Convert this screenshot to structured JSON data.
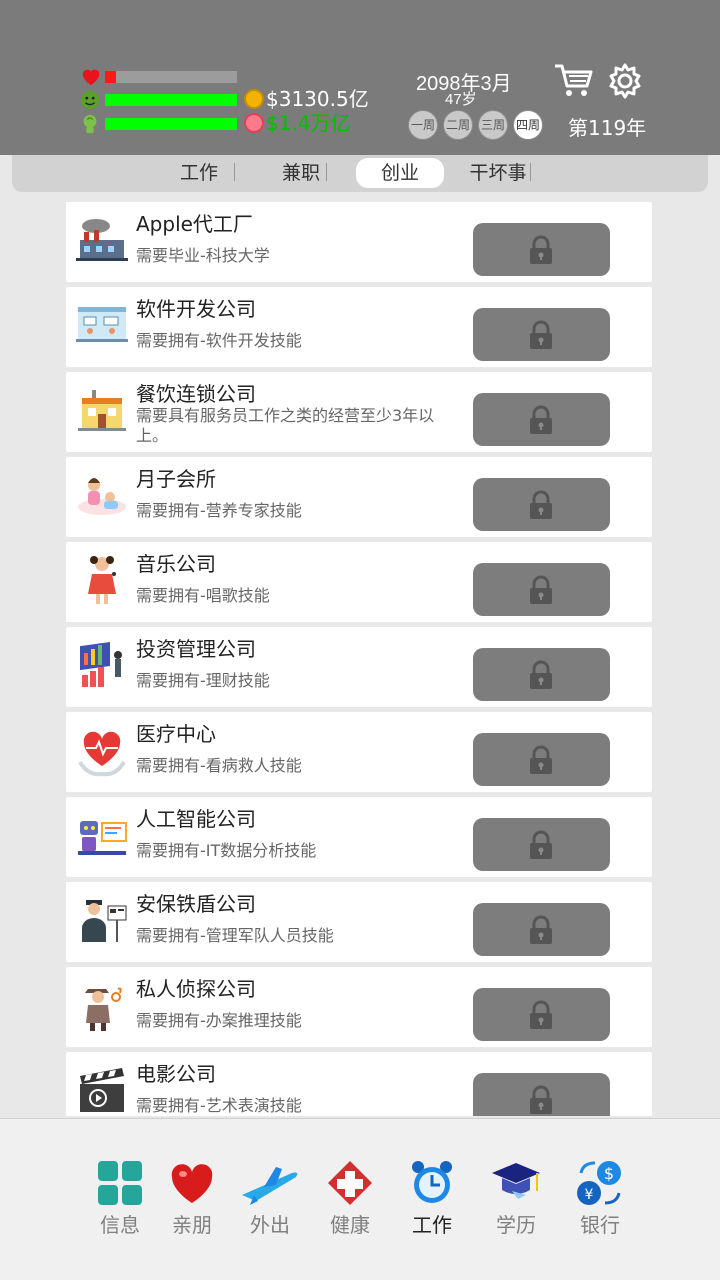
{
  "status": {
    "health_level": 0.08,
    "mood_level": 1.0,
    "energy_level": 1.0,
    "money": "$3130.5亿",
    "debt": "$1.4万亿",
    "date": "2098年3月",
    "age": "47岁",
    "weeks": [
      "一周",
      "二周",
      "三周",
      "四周"
    ],
    "active_week": 3,
    "turn": "第119年"
  },
  "tabs": [
    "工作",
    "兼职",
    "创业",
    "干坏事"
  ],
  "active_tab": 2,
  "businesses": [
    {
      "title": "Apple代工厂",
      "desc": "需要毕业-科技大学",
      "icon": "factory-icon"
    },
    {
      "title": "软件开发公司",
      "desc": "需要拥有-软件开发技能",
      "icon": "office-icon"
    },
    {
      "title": "餐饮连锁公司",
      "desc": "需要具有服务员工作之类的经营至少3年以上。",
      "icon": "restaurant-icon"
    },
    {
      "title": "月子会所",
      "desc": "需要拥有-营养专家技能",
      "icon": "mother-baby-icon"
    },
    {
      "title": "音乐公司",
      "desc": "需要拥有-唱歌技能",
      "icon": "singer-icon"
    },
    {
      "title": "投资管理公司",
      "desc": "需要拥有-理财技能",
      "icon": "investment-icon"
    },
    {
      "title": "医疗中心",
      "desc": "需要拥有-看病救人技能",
      "icon": "heart-medical-icon"
    },
    {
      "title": "人工智能公司",
      "desc": "需要拥有-IT数据分析技能",
      "icon": "robot-icon"
    },
    {
      "title": "安保铁盾公司",
      "desc": "需要拥有-管理军队人员技能",
      "icon": "security-guard-icon"
    },
    {
      "title": "私人侦探公司",
      "desc": "需要拥有-办案推理技能",
      "icon": "detective-icon"
    },
    {
      "title": "电影公司",
      "desc": "需要拥有-艺术表演技能",
      "icon": "clapperboard-icon"
    }
  ],
  "nav": [
    {
      "label": "信息",
      "icon": "info-grid-icon"
    },
    {
      "label": "亲朋",
      "icon": "heart-icon"
    },
    {
      "label": "外出",
      "icon": "airplane-icon"
    },
    {
      "label": "健康",
      "icon": "hospital-cross-icon"
    },
    {
      "label": "工作",
      "icon": "alarm-clock-icon"
    },
    {
      "label": "学历",
      "icon": "graduation-cap-icon"
    },
    {
      "label": "银行",
      "icon": "currency-exchange-icon"
    }
  ],
  "active_nav": 4,
  "colors": {
    "header_bg": "#7b7b7b",
    "health": "#ff1a1a",
    "energy": "#00ff00",
    "money_text": "#ffffff",
    "debt_text": "#00c000",
    "lock_button": "#7d7d7d"
  }
}
